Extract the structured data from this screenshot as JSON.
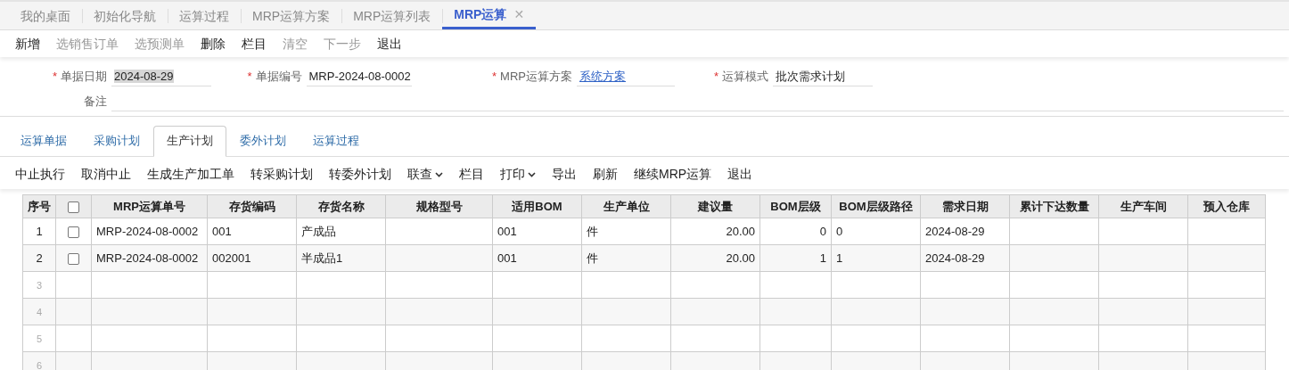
{
  "doc_tabs": [
    {
      "label": "我的桌面",
      "selected": false,
      "closable": false
    },
    {
      "label": "初始化导航",
      "selected": false,
      "closable": false
    },
    {
      "label": "运算过程",
      "selected": false,
      "closable": false
    },
    {
      "label": "MRP运算方案",
      "selected": false,
      "closable": false
    },
    {
      "label": "MRP运算列表",
      "selected": false,
      "closable": false
    },
    {
      "label": "MRP运算",
      "selected": true,
      "closable": true,
      "close_glyph": "✕"
    }
  ],
  "toolbar": [
    {
      "label": "新增",
      "disabled": false
    },
    {
      "label": "选销售订单",
      "disabled": true
    },
    {
      "label": "选预测单",
      "disabled": true
    },
    {
      "label": "删除",
      "disabled": false
    },
    {
      "label": "栏目",
      "disabled": false
    },
    {
      "label": "清空",
      "disabled": true
    },
    {
      "label": "下一步",
      "disabled": true
    },
    {
      "label": "退出",
      "disabled": false
    }
  ],
  "form": {
    "rows": [
      [
        {
          "label": "单据日期",
          "marker": "*",
          "kind": "input",
          "value": "2024-08-29",
          "highlighted": true
        },
        {
          "label": "单据编号",
          "marker": "*",
          "kind": "input",
          "value": "MRP-2024-08-0002"
        },
        {
          "label": "MRP运算方案",
          "marker": "*",
          "kind": "link",
          "value": "系统方案"
        },
        {
          "label": "运算模式",
          "marker": "*",
          "kind": "input",
          "value": "批次需求计划"
        }
      ],
      [
        {
          "label": "备注",
          "kind": "input"
        }
      ]
    ]
  },
  "sub_tabs": [
    {
      "label": "运算单据",
      "selected": false
    },
    {
      "label": "采购计划",
      "selected": false
    },
    {
      "label": "生产计划",
      "selected": true
    },
    {
      "label": "委外计划",
      "selected": false
    },
    {
      "label": "运算过程",
      "selected": false
    }
  ],
  "actions": [
    {
      "label": "中止执行",
      "dropdown": false
    },
    {
      "label": "取消中止",
      "dropdown": false
    },
    {
      "label": "生成生产加工单",
      "dropdown": false
    },
    {
      "label": "转采购计划",
      "dropdown": false
    },
    {
      "label": "转委外计划",
      "dropdown": false
    },
    {
      "label": "联查",
      "dropdown": true
    },
    {
      "label": "栏目",
      "dropdown": false
    },
    {
      "label": "打印",
      "dropdown": true
    },
    {
      "label": "导出",
      "dropdown": false
    },
    {
      "label": "刷新",
      "dropdown": false
    },
    {
      "label": "继续MRP运算",
      "dropdown": false
    },
    {
      "label": "退出",
      "dropdown": false
    }
  ],
  "table": {
    "columns": [
      {
        "label": "序号",
        "kind": "index"
      },
      {
        "kind": "checkbox",
        "checked": false
      },
      {
        "label": "MRP运算单号",
        "kind": "text"
      },
      {
        "label": "存货编码",
        "kind": "text"
      },
      {
        "label": "存货名称",
        "kind": "text"
      },
      {
        "label": "规格型号",
        "kind": "text"
      },
      {
        "label": "适用BOM",
        "kind": "text"
      },
      {
        "label": "生产单位",
        "kind": "text"
      },
      {
        "label": "建议量",
        "kind": "number"
      },
      {
        "label": "BOM层级",
        "kind": "number"
      },
      {
        "label": "BOM层级路径",
        "kind": "text"
      },
      {
        "label": "需求日期",
        "kind": "text"
      },
      {
        "label": "累计下达数量",
        "kind": "number"
      },
      {
        "label": "生产车间",
        "kind": "text"
      },
      {
        "label": "预入仓库",
        "kind": "text"
      }
    ],
    "rows": [
      {
        "checked": false,
        "cells": [
          "1",
          "",
          "MRP-2024-08-0002",
          "001",
          "产成品",
          "",
          "001",
          "件",
          "20.00",
          "0",
          "0",
          "2024-08-29",
          "",
          "",
          ""
        ]
      },
      {
        "checked": false,
        "cells": [
          "2",
          "",
          "MRP-2024-08-0002",
          "002001",
          "半成品1",
          "",
          "001",
          "件",
          "20.00",
          "1",
          "1",
          "2024-08-29",
          "",
          "",
          ""
        ]
      }
    ],
    "empty_rows": [
      "3",
      "4",
      "5",
      "6"
    ]
  }
}
